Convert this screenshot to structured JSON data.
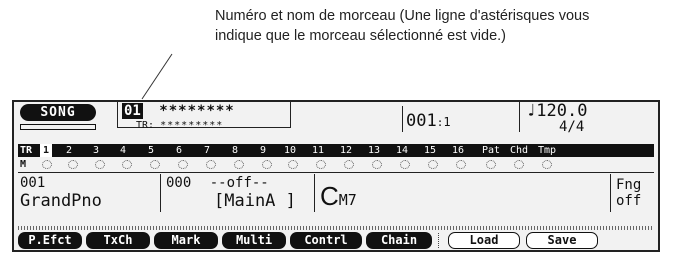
{
  "annotation": {
    "line1": "Numéro et nom de morceau (Une ligne d'astérisques vous",
    "line2": "indique que le morceau sélectionné est vide.)"
  },
  "lcd": {
    "mode_label": "SONG",
    "song_number": "01",
    "song_name": "********",
    "track_label": "TR",
    "track_name": "*********",
    "measure": "001",
    "beat": "1",
    "tempo_note": "♩",
    "tempo": "120.0",
    "time_signature": "4/4",
    "track_row": {
      "label": "TR",
      "numbers": [
        "1",
        "2",
        "3",
        "4",
        "5",
        "6",
        "7",
        "8",
        "9",
        "10",
        "11",
        "12",
        "13",
        "14",
        "15",
        "16"
      ],
      "extras": [
        "Pat",
        "Chd",
        "Tmp"
      ]
    },
    "mute_label": "M",
    "voice_number": "001",
    "voice_name": "GrandPno",
    "pattern_number": "000",
    "pattern_status": "--off--",
    "pattern_section": "[MainA ]",
    "chord_root": "C",
    "chord_type": "M7",
    "fng_label": "Fng",
    "fng_value": "off",
    "buttons": [
      "P.Efct",
      "TxCh",
      "Mark",
      "Multi",
      "Contrl",
      "Chain",
      "Load",
      "Save"
    ]
  }
}
